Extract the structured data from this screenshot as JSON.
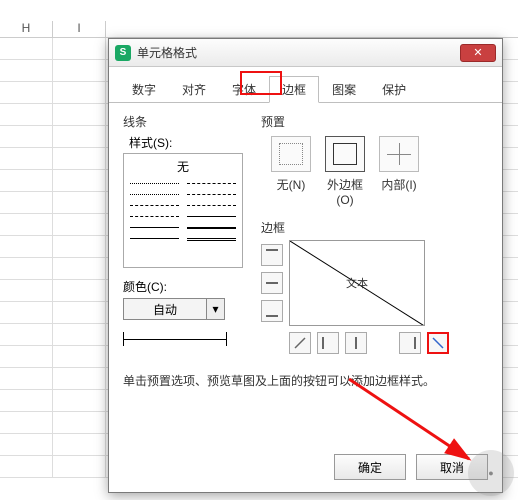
{
  "sheet": {
    "columns": [
      "H",
      "I"
    ]
  },
  "dialog": {
    "title": "单元格格式",
    "tabs": [
      "数字",
      "对齐",
      "字体",
      "边框",
      "图案",
      "保护"
    ],
    "active_tab_index": 3,
    "lines": {
      "group_label": "线条",
      "style_label": "样式(S):",
      "none_label": "无",
      "color_label": "颜色(C):",
      "color_value": "自动"
    },
    "preset": {
      "group_label": "预置",
      "none": "无(N)",
      "outline": "外边框(O)",
      "inside": "内部(I)"
    },
    "border": {
      "group_label": "边框",
      "preview_text": "文本"
    },
    "hint": "单击预置选项、预览草图及上面的按钮可以添加边框样式。",
    "buttons": {
      "ok": "确定",
      "cancel": "取消"
    }
  }
}
